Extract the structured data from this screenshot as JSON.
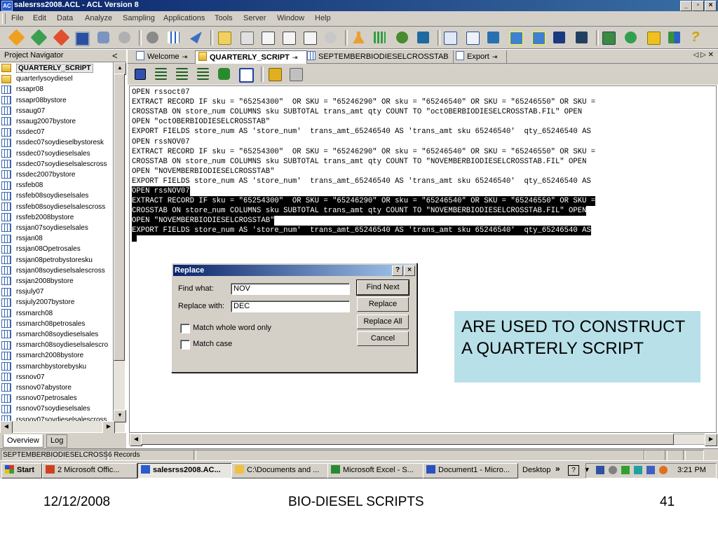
{
  "window": {
    "title": "salesrss2008.ACL - ACL Version 8",
    "minimize": "_",
    "restore": "▫",
    "close": "×"
  },
  "menu": [
    "File",
    "Edit",
    "Data",
    "Analyze",
    "Sampling",
    "Applications",
    "Tools",
    "Server",
    "Window",
    "Help"
  ],
  "navigator": {
    "title": "Project Navigator",
    "collapse": "<",
    "items": [
      {
        "label": "QUARTERLY_SCRIPT",
        "kind": "script",
        "selected": true
      },
      {
        "label": "quarterlysoydiesel",
        "kind": "script"
      },
      {
        "label": "rssapr08",
        "kind": "table"
      },
      {
        "label": "rssapr08bystore",
        "kind": "table"
      },
      {
        "label": "rssaug07",
        "kind": "table"
      },
      {
        "label": "rssaug2007bystore",
        "kind": "table"
      },
      {
        "label": "rssdec07",
        "kind": "table"
      },
      {
        "label": "rssdec07soydieselbystoresk",
        "kind": "table"
      },
      {
        "label": "rssdec07soydieselsales",
        "kind": "table"
      },
      {
        "label": "rssdec07soydieselsalescross",
        "kind": "table"
      },
      {
        "label": "rssdec2007bystore",
        "kind": "table"
      },
      {
        "label": "rssfeb08",
        "kind": "table"
      },
      {
        "label": "rssfeb08soydieselsales",
        "kind": "table"
      },
      {
        "label": "rssfeb08soydieselsalescross",
        "kind": "table"
      },
      {
        "label": "rssfeb2008bystore",
        "kind": "table"
      },
      {
        "label": "rssjan07soydieselsales",
        "kind": "table"
      },
      {
        "label": "rssjan08",
        "kind": "table"
      },
      {
        "label": "rssjan08Opetrosales",
        "kind": "table"
      },
      {
        "label": "rssjan08petrobystoresku",
        "kind": "table"
      },
      {
        "label": "rssjan08soydieselsalescross",
        "kind": "table"
      },
      {
        "label": "rssjan2008bystore",
        "kind": "table"
      },
      {
        "label": "rssjuly07",
        "kind": "table"
      },
      {
        "label": "rssjuly2007bystore",
        "kind": "table"
      },
      {
        "label": "rssmarch08",
        "kind": "table"
      },
      {
        "label": "rssmarch08petrosales",
        "kind": "table"
      },
      {
        "label": "rssmarch08soydieselsales",
        "kind": "table"
      },
      {
        "label": "rssmarch08soydieselsalescro",
        "kind": "table"
      },
      {
        "label": "rssmarch2008bystore",
        "kind": "table"
      },
      {
        "label": "rssmarchbystorebysku",
        "kind": "table"
      },
      {
        "label": "rssnov07",
        "kind": "table"
      },
      {
        "label": "rssnov07abystore",
        "kind": "table"
      },
      {
        "label": "rssnov07petrosales",
        "kind": "table"
      },
      {
        "label": "rssnov07soydieselsales",
        "kind": "table"
      },
      {
        "label": "rssnov07soydieselsalescross",
        "kind": "table"
      }
    ],
    "tabs": [
      "Overview",
      "Log"
    ]
  },
  "doc_tabs": [
    {
      "label": "Welcome",
      "icon": "page",
      "pin": "⇥"
    },
    {
      "label": "QUARTERLY_SCRIPT",
      "icon": "script",
      "pin": "⇥",
      "active": true
    },
    {
      "label": "SEPTEMBERBIODIESELCROSSTAB",
      "icon": "table",
      "pin": ""
    },
    {
      "label": "Export",
      "icon": "page",
      "pin": "⇥"
    }
  ],
  "tab_nav": "◁ ▷ ✕",
  "editor": {
    "lines": [
      {
        "text": "OPEN rssoct07",
        "hl": false
      },
      {
        "text": "EXTRACT RECORD IF sku = \"65254300\"  OR SKU = \"65246290\" OR sku = \"65246540\" OR SKU = \"65246550\" OR SKU =",
        "hl": false
      },
      {
        "text": "CROSSTAB ON store_num COLUMNS sku SUBTOTAL trans_amt qty COUNT TO \"octOBERBIODIESELCROSSTAB.FIL\" OPEN",
        "hl": false
      },
      {
        "text": "OPEN \"octOBERBIODIESELCROSSTAB\"",
        "hl": false
      },
      {
        "text": "EXPORT FIELDS store_num AS 'store_num'  trans_amt_65246540 AS 'trans_amt sku 65246540'  qty_65246540 AS",
        "hl": false
      },
      {
        "text": "OPEN rssNOV07",
        "hl": false
      },
      {
        "text": "EXTRACT RECORD IF sku = \"65254300\"  OR SKU = \"65246290\" OR sku = \"65246540\" OR SKU = \"65246550\" OR SKU =",
        "hl": false
      },
      {
        "text": "CROSSTAB ON store_num COLUMNS sku SUBTOTAL trans_amt qty COUNT TO \"NOVEMBERBIODIESELCROSSTAB.FIL\" OPEN",
        "hl": false
      },
      {
        "text": "OPEN \"NOVEMBERBIODIESELCROSSTAB\"",
        "hl": false
      },
      {
        "text": "EXPORT FIELDS store_num AS 'store_num'  trans_amt_65246540 AS 'trans_amt sku 65246540'  qty_65246540 AS",
        "hl": false
      },
      {
        "text": "OPEN rssNOV07",
        "hl": true
      },
      {
        "text": "EXTRACT RECORD IF sku = \"65254300\"  OR SKU = \"65246290\" OR sku = \"65246540\" OR SKU = \"65246550\" OR SKU =",
        "hl": true
      },
      {
        "text": "CROSSTAB ON store_num COLUMNS sku SUBTOTAL trans_amt qty COUNT TO \"NOVEMBERBIODIESELCROSSTAB.FIL\" OPEN",
        "hl": true
      },
      {
        "text": "OPEN \"NOVEMBERBIODIESELCROSSTAB\"",
        "hl": true
      },
      {
        "text": "EXPORT FIELDS store_num AS 'store_num'  trans_amt_65246540 AS 'trans_amt sku 65246540'  qty_65246540 AS",
        "hl": true
      }
    ]
  },
  "dialog": {
    "title": "Replace",
    "help": "?",
    "close": "×",
    "find_label": "Find what:",
    "find_value": "NOV",
    "replace_label": "Replace with:",
    "replace_value": "DEC",
    "match_whole_word": "Match whole word only",
    "match_case": "Match case",
    "find_next": "Find Next",
    "replace": "Replace",
    "replace_all": "Replace All",
    "cancel": "Cancel"
  },
  "status": {
    "table": "SEPTEMBERBIODIESELCROSST",
    "records": "6 Records"
  },
  "taskbar": {
    "start": "Start",
    "items": [
      {
        "label": "2 Microsoft Offic...",
        "active": false
      },
      {
        "label": "salesrss2008.AC...",
        "active": true
      },
      {
        "label": "C:\\Documents and ...",
        "active": false
      },
      {
        "label": "Microsoft Excel - S...",
        "active": false
      },
      {
        "label": "Document1 - Micro...",
        "active": false
      }
    ],
    "desktop": "Desktop",
    "chevron": "»",
    "clock": "3:21 PM"
  },
  "callout": {
    "text": "ARE USED TO CONSTRUCT A QUARTERLY SCRIPT"
  },
  "footer": {
    "date": "12/12/2008",
    "title": "BIO-DIESEL SCRIPTS",
    "page": "41"
  }
}
